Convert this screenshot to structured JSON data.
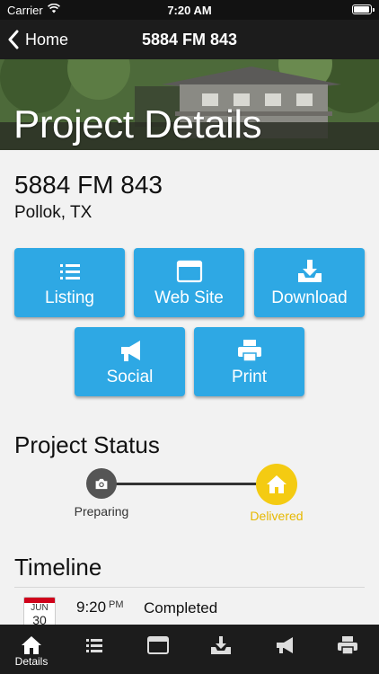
{
  "status_bar": {
    "carrier": "Carrier",
    "time": "7:20 AM",
    "battery_level": 0.95
  },
  "nav": {
    "back_label": "Home",
    "title": "5884 FM 843"
  },
  "hero": {
    "title": "Project Details"
  },
  "address": {
    "street": "5884 FM 843",
    "city": "Pollok, TX"
  },
  "actions": [
    {
      "label": "Listing",
      "icon": "list-icon"
    },
    {
      "label": "Web Site",
      "icon": "browser-icon"
    },
    {
      "label": "Download",
      "icon": "download-icon"
    },
    {
      "label": "Social",
      "icon": "megaphone-icon"
    },
    {
      "label": "Print",
      "icon": "printer-icon"
    }
  ],
  "project_status": {
    "heading": "Project Status",
    "steps": [
      {
        "label": "Preparing",
        "icon": "camera-icon",
        "color": "#555555"
      },
      {
        "label": "Delivered",
        "icon": "home-icon",
        "color": "#f4cb12"
      }
    ]
  },
  "timeline": {
    "heading": "Timeline",
    "entries": [
      {
        "month": "JUN",
        "day": "30",
        "time": "9:20",
        "ampm": "PM",
        "event": "Completed"
      }
    ]
  },
  "tab_bar": {
    "tabs": [
      {
        "label": "Details",
        "icon": "home-icon",
        "active": true
      },
      {
        "label": "",
        "icon": "list-icon"
      },
      {
        "label": "",
        "icon": "browser-icon"
      },
      {
        "label": "",
        "icon": "download-icon"
      },
      {
        "label": "",
        "icon": "megaphone-icon"
      },
      {
        "label": "",
        "icon": "printer-icon"
      }
    ]
  },
  "colors": {
    "accent": "#2ea8e4",
    "delivered": "#f4cb12",
    "bar": "#1c1c1c"
  }
}
